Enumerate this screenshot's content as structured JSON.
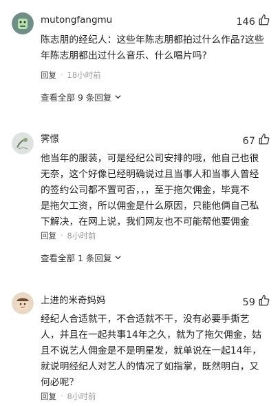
{
  "comments": [
    {
      "username": "mutongfangmu",
      "likes": "146",
      "lines": [
        "陈志朋的经纪人：这些年陈志朋都拍过什么作品?这些",
        "年陈志朋都出过什么音乐、什么唱片吗?"
      ],
      "reply_label": "回复",
      "time": "18小时前",
      "view_replies": "查看全部 9 条回复"
    },
    {
      "username": "霁憬",
      "likes": "67",
      "lines": [
        "他当年的服装，可是经纪公司安排的哦，他自己也很",
        "无奈，这个好像已经明确说过且当事人和当事人曾经",
        "的签约公司都不置可否，，，至于拖欠佣金，毕竟不",
        "是拖欠工资，所以佣金是什么原因，只能他俩自己私",
        "下解决，在网上说，我们网友也不可能帮他要佣金"
      ],
      "reply_label": "回复",
      "time": "8小时前",
      "view_replies": "查看全部 1 条回复"
    },
    {
      "username": "上进的米奇妈妈",
      "likes": "59",
      "lines": [
        "经纪人合适就干，不合适就不干，没有必要手撕艺",
        "人，并且在一起共事14年之久，就为了拖欠佣金，姑",
        "且不说艺人佣金是不是明星发，就单说在一起14年，",
        "就说明经纪人对艺人的情况了如指掌，既然明白，又",
        "何必呢？"
      ],
      "reply_label": "回复",
      "time": "8小时前"
    }
  ]
}
